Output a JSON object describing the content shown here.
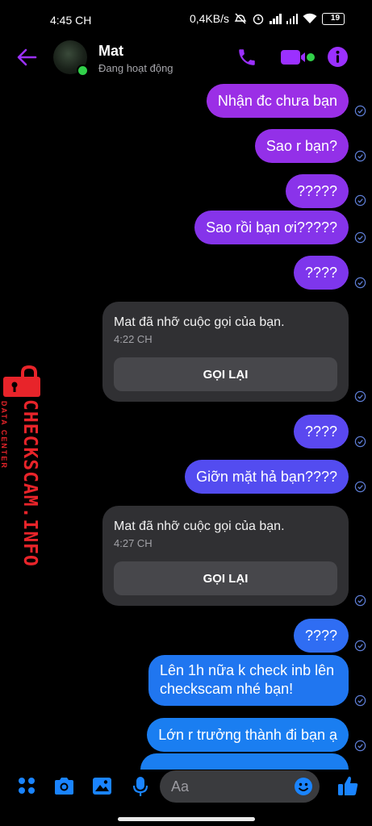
{
  "status_bar": {
    "time": "4:45 CH",
    "network_speed": "0,4KB/s",
    "battery": "19",
    "battery_level": 0.19,
    "icons": [
      "mute-icon",
      "alarm-icon",
      "signal-icon",
      "signal-icon",
      "wifi-icon",
      "battery-icon"
    ]
  },
  "header": {
    "contact_name": "Mat",
    "presence": "Đang hoạt động",
    "icons": [
      "back-arrow-icon",
      "phone-icon",
      "video-icon",
      "info-icon"
    ],
    "accent_color": "#9b30ff"
  },
  "messages": [
    {
      "text": "Nhận đc chưa bạn",
      "color": "#9b2fe6"
    },
    {
      "text": "Sao r bạn?",
      "color": "#9330e8"
    },
    {
      "text": "?????",
      "color": "#8a33ea"
    },
    {
      "text": "Sao rồi bạn ơi?????",
      "color": "#8534ea"
    },
    {
      "text": "????",
      "color": "#7e36ec"
    },
    {
      "text": "????",
      "color": "#5a48f0"
    },
    {
      "text": "Giỡn mặt hả bạn????",
      "color": "#534cf0"
    },
    {
      "text": "????",
      "color": "#2f6df3"
    },
    {
      "text": "Lên 1h nữa k check inb lên checkscam nhé bạn!",
      "color": "#2076f0"
    },
    {
      "text": "Lớn r trưởng thành đi bạn ạ",
      "color": "#1a7ef1"
    }
  ],
  "missed_calls": [
    {
      "title": "Mat đã nhỡ cuộc gọi của bạn.",
      "time": "4:22 CH",
      "button": "GỌI LẠI"
    },
    {
      "title": "Mat đã nhỡ cuộc gọi của bạn.",
      "time": "4:27 CH",
      "button": "GỌI LẠI"
    }
  ],
  "watermark": {
    "main": "CHECKSCAM.INFO",
    "sub": "DATA CENTER",
    "color": "#e8242a"
  },
  "composer": {
    "placeholder": "Aa",
    "icons": [
      "menu-dots-icon",
      "camera-icon",
      "gallery-icon",
      "microphone-icon",
      "emoji-icon",
      "like-icon"
    ],
    "accent_color": "#1a84ff"
  }
}
